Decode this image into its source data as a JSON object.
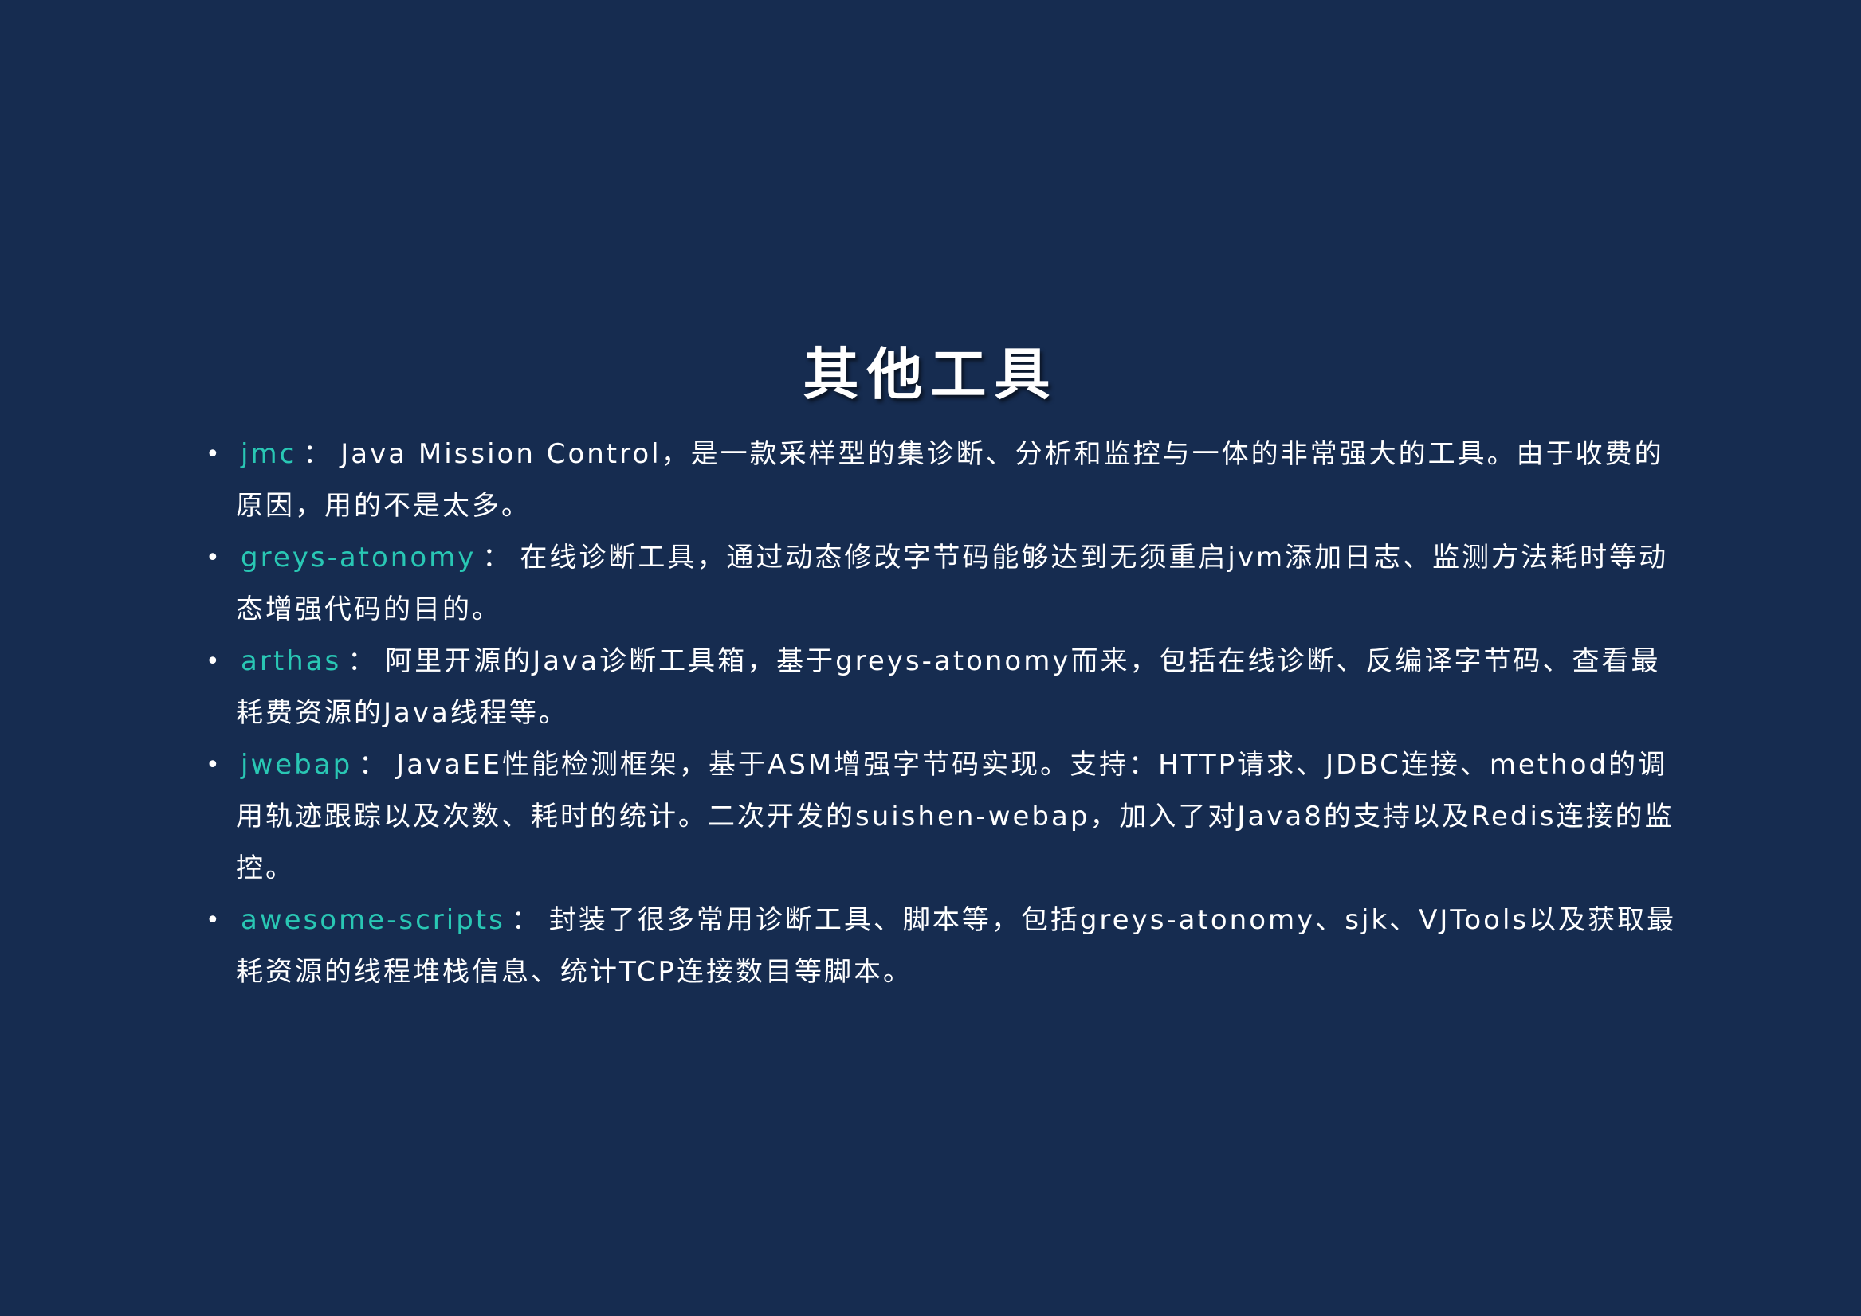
{
  "slide": {
    "title": "其他工具",
    "colors": {
      "background": "#162c50",
      "text": "#ffffff",
      "accent": "#29c7b4"
    },
    "items": [
      {
        "name": "jmc",
        "separator": "：",
        "description": "Java Mission Control，是一款采样型的集诊断、分析和监控与一体的非常强大的工具。由于收费的原因，用的不是太多。"
      },
      {
        "name": "greys-atonomy",
        "separator": "：",
        "description": "在线诊断工具，通过动态修改字节码能够达到无须重启jvm添加日志、监测方法耗时等动态增强代码的目的。"
      },
      {
        "name": "arthas",
        "separator": "：",
        "description": "阿里开源的Java诊断工具箱，基于greys-atonomy而来，包括在线诊断、反编译字节码、查看最耗费资源的Java线程等。"
      },
      {
        "name": "jwebap",
        "separator": "：",
        "description": "JavaEE性能检测框架，基于ASM增强字节码实现。支持：HTTP请求、JDBC连接、method的调用轨迹跟踪以及次数、耗时的统计。二次开发的suishen-webap，加入了对Java8的支持以及Redis连接的监控。"
      },
      {
        "name": "awesome-scripts",
        "separator": "：",
        "description": "封装了很多常用诊断工具、脚本等，包括greys-atonomy、sjk、VJTools以及获取最耗资源的线程堆栈信息、统计TCP连接数目等脚本。"
      }
    ]
  }
}
